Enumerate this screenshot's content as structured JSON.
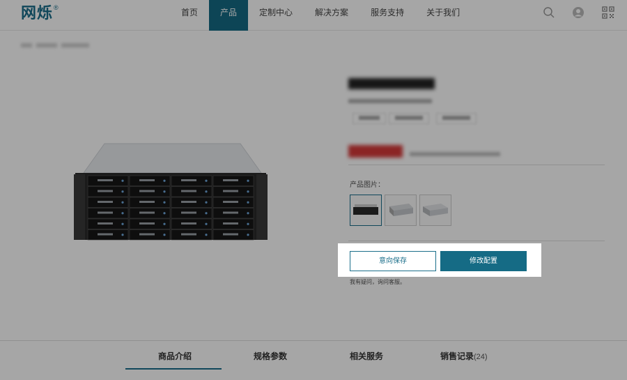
{
  "brand": {
    "logo_text": "网烁",
    "logo_mark": "®"
  },
  "nav": {
    "items": [
      {
        "label": "首页"
      },
      {
        "label": "产品"
      },
      {
        "label": "定制中心"
      },
      {
        "label": "解决方案"
      },
      {
        "label": "服务支持"
      },
      {
        "label": "关于我们"
      }
    ],
    "active": "产品",
    "icons": [
      "search-icon",
      "user-avatar-icon",
      "qr-code-icon"
    ]
  },
  "product": {
    "images_label": "产品图片：",
    "thumbnails": [
      "server-front-thumb",
      "server-side-thumb",
      "server-top-thumb"
    ],
    "selected_thumbnail": 0
  },
  "actions": {
    "save_label": "意向保存",
    "configure_label": "修改配置",
    "help_text": "我有疑问，询问客服。"
  },
  "tabs": {
    "items": [
      {
        "label": "商品介绍",
        "count": ""
      },
      {
        "label": "规格参数",
        "count": ""
      },
      {
        "label": "相关服务",
        "count": ""
      },
      {
        "label": "销售记录",
        "count": "(24)"
      }
    ],
    "active": "商品介绍"
  },
  "colors": {
    "accent": "#156b85",
    "overlay": "rgba(0,0,0,0.35)"
  }
}
